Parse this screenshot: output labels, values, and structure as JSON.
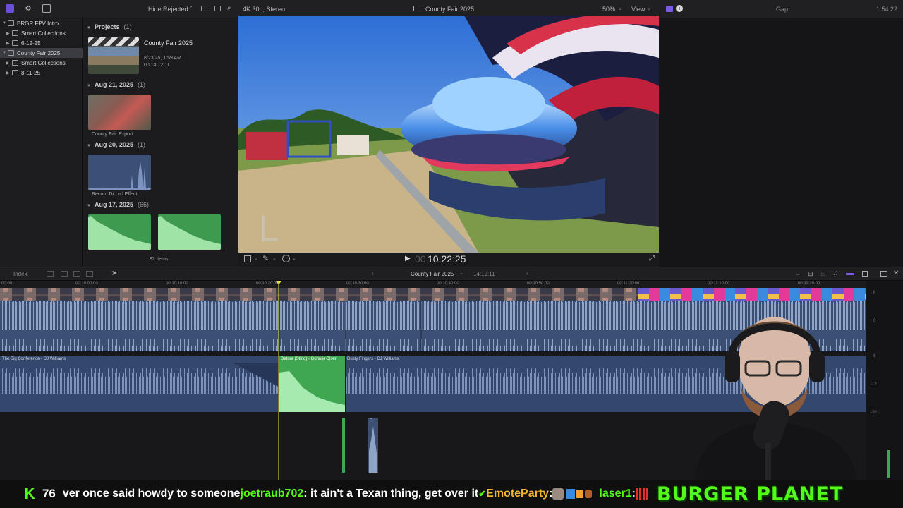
{
  "topbar": {
    "filter": "Hide Rejected",
    "format": "4K 30p, Stereo",
    "project_title": "County Fair 2025",
    "zoom": "50%",
    "view": "View",
    "inspector_title": "Gap",
    "inspector_time": "1:54:22"
  },
  "library": {
    "items": [
      {
        "label": "BRGR FPV Intro",
        "type": "library",
        "selected": false
      },
      {
        "label": "Smart Collections",
        "type": "folder",
        "selected": false
      },
      {
        "label": "6-12-25",
        "type": "event",
        "selected": false
      },
      {
        "label": "County Fair 2025",
        "type": "library",
        "selected": true
      },
      {
        "label": "Smart Collections",
        "type": "folder",
        "selected": false
      },
      {
        "label": "8-11-25",
        "type": "event",
        "selected": false
      }
    ]
  },
  "browser": {
    "projects_header": "Projects",
    "projects_count": "(1)",
    "project_name": "County Fair 2025",
    "project_date": "8/23/25, 1:59 AM",
    "project_duration": "00:14:12:11",
    "groups": [
      {
        "date": "Aug 21, 2025",
        "count": "(1)",
        "caption": "County Fair Export"
      },
      {
        "date": "Aug 20, 2025",
        "count": "(1)",
        "caption": "Record Di...nd Effect"
      },
      {
        "date": "Aug 17, 2025",
        "count": "(66)",
        "caption": ""
      }
    ],
    "item_count": "82 items"
  },
  "viewer": {
    "timecode": "10:22:25",
    "timecode_prefix": "00"
  },
  "timeline_bar": {
    "index": "Index",
    "project": "County Fair 2025",
    "duration": "14:12:11"
  },
  "timeline": {
    "ruler": [
      "00:00",
      "00:10:00:00",
      "00:10:10:00",
      "00:10:20:00",
      "00:10:30:00",
      "00:10:40:00",
      "00:10:50:00",
      "00:11:00:00",
      "00:11:10:00",
      "00:11:20:00"
    ],
    "music_clips": [
      "The Big Conference - DJ Williams",
      "Detour (Sting) - Gunnar Olsen",
      "Dusty Fingers - DJ Williams"
    ],
    "small_clip_label": "C...",
    "meter_scale": [
      "6",
      "0",
      "-6",
      "-12",
      "-20"
    ]
  },
  "ticker": {
    "brand": "K",
    "viewer_count": "76",
    "segments": [
      {
        "kind": "w",
        "text": "ver once said howdy to someone "
      },
      {
        "kind": "u",
        "text": "joetraub702"
      },
      {
        "kind": "w",
        "text": " : it ain't a Texan thing, get over it "
      },
      {
        "kind": "check",
        "text": "✔"
      },
      {
        "kind": "o",
        "text": " EmoteParty"
      },
      {
        "kind": "w",
        "text": " : "
      },
      {
        "kind": "u",
        "text": "laser1"
      },
      {
        "kind": "w",
        "text": " : "
      }
    ],
    "banner": "BURGER PLANET"
  },
  "colors": {
    "accent_purple": "#7b5ce0",
    "audio_blue": "#3c4f74",
    "sting_green": "#3fa652",
    "playhead": "#e6e04a",
    "kick_green": "#53fc18"
  }
}
